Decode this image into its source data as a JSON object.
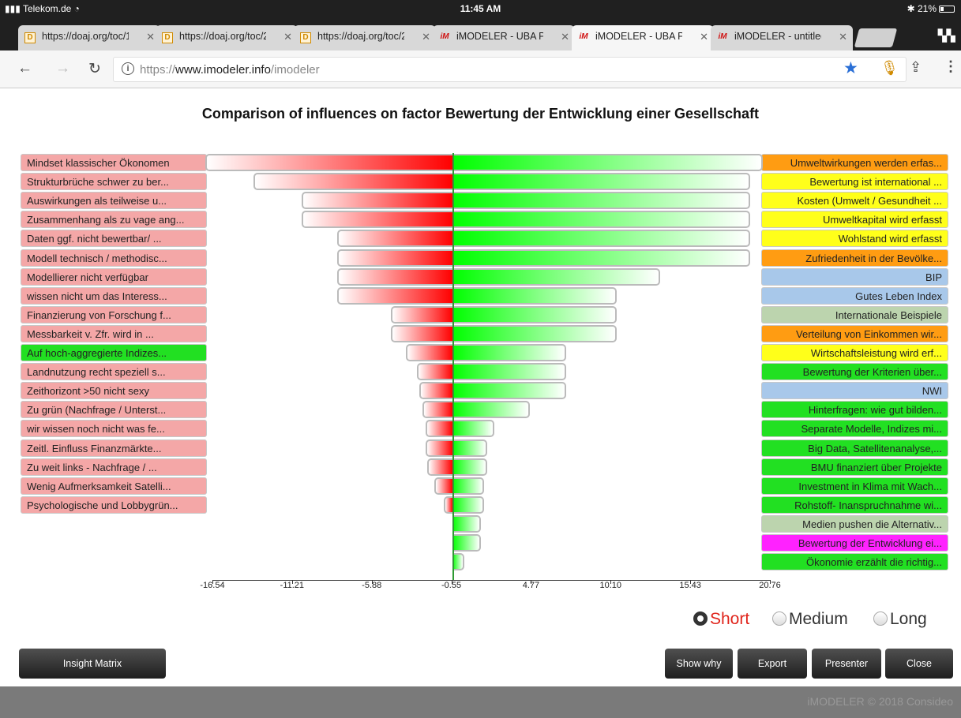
{
  "status": {
    "carrier": "Telekom.de",
    "time": "11:45 AM",
    "battery": "21%"
  },
  "tabs": [
    {
      "title": "https://doaj.org/toc/1",
      "favicon": "D",
      "active": false
    },
    {
      "title": "https://doaj.org/toc/2",
      "favicon": "D",
      "active": false
    },
    {
      "title": "https://doaj.org/toc/2",
      "favicon": "D",
      "active": false
    },
    {
      "title": "iMODELER - UBA Proj",
      "favicon": "iM",
      "active": false
    },
    {
      "title": "iMODELER - UBA Proj",
      "favicon": "iM",
      "active": true
    },
    {
      "title": "iMODELER - untitled",
      "favicon": "iM",
      "active": false
    }
  ],
  "addressbar": {
    "scheme": "https://",
    "host": "www.imodeler.info",
    "path": "/imodeler"
  },
  "chart_data": {
    "type": "bar",
    "title": "Comparison of influences on factor Bewertung der Entwicklung einer Gesellschaft",
    "xlim": [
      -16.54,
      20.76
    ],
    "ticks": [
      "-16.54",
      "-11.21",
      "-5.88",
      "-0.55",
      "4.77",
      "10.10",
      "15.43",
      "20.76"
    ],
    "negative": [
      {
        "label": "Mindset klassischer Ökonomen",
        "value": -16.54,
        "color": "#f4a7a7"
      },
      {
        "label": "Strukturbrüche schwer zu ber...",
        "value": -13.3,
        "color": "#f4a7a7"
      },
      {
        "label": "Auswirkungen als teilweise u...",
        "value": -10.1,
        "color": "#f4a7a7"
      },
      {
        "label": "Zusammenhang als zu vage ang...",
        "value": -10.1,
        "color": "#f4a7a7"
      },
      {
        "label": "Daten ggf. nicht bewertbar/ ...",
        "value": -7.7,
        "color": "#f4a7a7"
      },
      {
        "label": "Modell technisch / methodisc...",
        "value": -7.7,
        "color": "#f4a7a7"
      },
      {
        "label": "Modellierer nicht verfügbar",
        "value": -7.7,
        "color": "#f4a7a7"
      },
      {
        "label": "wissen nicht um das Interess...",
        "value": -7.7,
        "color": "#f4a7a7"
      },
      {
        "label": "Finanzierung von Forschung f...",
        "value": -4.1,
        "color": "#f4a7a7"
      },
      {
        "label": "Messbarkeit v. Zfr. wird in ...",
        "value": -4.1,
        "color": "#f4a7a7"
      },
      {
        "label": "Auf hoch-aggregierte Indizes...",
        "value": -3.1,
        "color": "#22e022"
      },
      {
        "label": "Landnutzung recht speziell s...",
        "value": -2.4,
        "color": "#f4a7a7"
      },
      {
        "label": "Zeithorizont >50 nicht sexy",
        "value": -2.2,
        "color": "#f4a7a7"
      },
      {
        "label": "Zu grün (Nachfrage / Unterst...",
        "value": -2.0,
        "color": "#f4a7a7"
      },
      {
        "label": "wir wissen noch nicht was fe...",
        "value": -1.8,
        "color": "#f4a7a7"
      },
      {
        "label": "Zeitl. Einfluss Finanzmärkte...",
        "value": -1.8,
        "color": "#f4a7a7"
      },
      {
        "label": "Zu weit links - Nachfrage / ...",
        "value": -1.7,
        "color": "#f4a7a7"
      },
      {
        "label": "Wenig Aufmerksamkeit Satelli...",
        "value": -1.2,
        "color": "#f4a7a7"
      },
      {
        "label": "Psychologische und Lobbygrün...",
        "value": -0.6,
        "color": "#f4a7a7"
      }
    ],
    "positive": [
      {
        "label": "Umweltwirkungen werden erfas...",
        "value": 20.76,
        "color": "#ff9c12"
      },
      {
        "label": "Bewertung ist international ...",
        "value": 19.9,
        "color": "#ffff1a"
      },
      {
        "label": "Kosten (Umwelt / Gesundheit ...",
        "value": 19.9,
        "color": "#ffff1a"
      },
      {
        "label": "Umweltkapital wird erfasst",
        "value": 19.9,
        "color": "#ffff1a"
      },
      {
        "label": "Wohlstand wird erfasst",
        "value": 19.9,
        "color": "#ffff1a"
      },
      {
        "label": "Zufriedenheit in der Bevölke...",
        "value": 19.9,
        "color": "#ff9c12"
      },
      {
        "label": "BIP",
        "value": 13.9,
        "color": "#a8c8ea"
      },
      {
        "label": "Gutes Leben Index",
        "value": 11.0,
        "color": "#a8c8ea"
      },
      {
        "label": "Internationale Beispiele",
        "value": 11.0,
        "color": "#bcd4ae"
      },
      {
        "label": "Verteilung von Einkommen wir...",
        "value": 11.0,
        "color": "#ff9c12"
      },
      {
        "label": "Wirtschaftsleistung wird erf...",
        "value": 7.6,
        "color": "#ffff1a"
      },
      {
        "label": "Bewertung der Kriterien über...",
        "value": 7.6,
        "color": "#22e022"
      },
      {
        "label": "NWI",
        "value": 7.6,
        "color": "#a8c8ea"
      },
      {
        "label": "Hinterfragen: wie gut bilden...",
        "value": 5.2,
        "color": "#22e022"
      },
      {
        "label": "Separate Modelle, Indizes mi...",
        "value": 2.8,
        "color": "#22e022"
      },
      {
        "label": "Big Data, Satellitenanalyse,...",
        "value": 2.3,
        "color": "#22e022"
      },
      {
        "label": "BMU finanziert über Projekte",
        "value": 2.3,
        "color": "#22e022"
      },
      {
        "label": "Investment in Klima mit Wach...",
        "value": 2.1,
        "color": "#22e022"
      },
      {
        "label": "Rohstoff- Inanspruchnahme wi...",
        "value": 2.1,
        "color": "#22e022"
      },
      {
        "label": "Medien pushen die Alternativ...",
        "value": 1.9,
        "color": "#bcd4ae"
      },
      {
        "label": "Bewertung der Entwicklung ei...",
        "value": 1.9,
        "color": "#ff22ff"
      },
      {
        "label": "Ökonomie erzählt die richtig...",
        "value": 0.8,
        "color": "#22e022"
      }
    ]
  },
  "timeframe": {
    "options": [
      "Short",
      "Medium",
      "Long"
    ],
    "selected": "Short"
  },
  "buttons": {
    "insight": "Insight Matrix",
    "show_why": "Show why",
    "export": "Export",
    "presenter": "Presenter",
    "close": "Close"
  },
  "footer": "iMODELER © 2018 Consideo"
}
